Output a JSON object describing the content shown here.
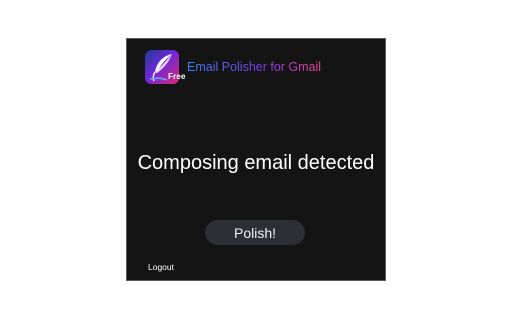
{
  "header": {
    "logo_icon": "feather-quill-icon",
    "badge": "Free",
    "title": "Email Polisher for Gmail"
  },
  "main": {
    "status_text": "Composing email detected",
    "polish_label": "Polish!"
  },
  "footer": {
    "logout_label": "Logout"
  },
  "colors": {
    "panel_bg": "#141414",
    "button_bg": "#2d2f36",
    "title_gradient": [
      "#3b82f6",
      "#7c3aed",
      "#ec4899"
    ]
  }
}
